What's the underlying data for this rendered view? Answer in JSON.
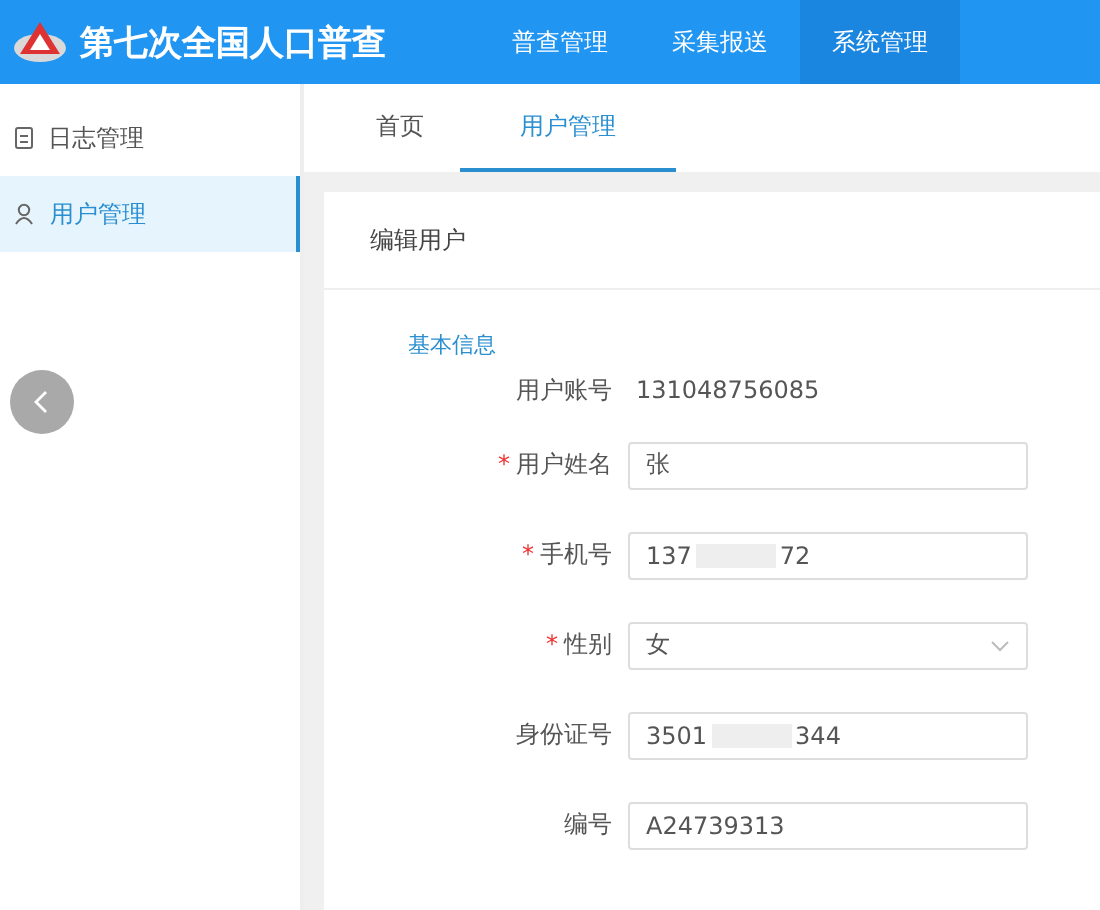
{
  "header": {
    "title": "第七次全国人口普查",
    "nav": [
      {
        "label": "普查管理",
        "selected": false
      },
      {
        "label": "采集报送",
        "selected": false
      },
      {
        "label": "系统管理",
        "selected": true
      }
    ]
  },
  "sidebar": {
    "items": [
      {
        "label": "日志管理",
        "kind": "log",
        "selected": false
      },
      {
        "label": "用户管理",
        "kind": "user",
        "selected": true
      }
    ]
  },
  "tabs": [
    {
      "label": "首页",
      "selected": false
    },
    {
      "label": "用户管理",
      "selected": true
    }
  ],
  "card": {
    "title": "编辑用户",
    "section": "基本信息",
    "fields": [
      {
        "kind": "text",
        "label": "用户账号",
        "start": "131048756085"
      },
      {
        "kind": "input",
        "label": "用户姓名",
        "required_mark": "*",
        "start": "张"
      },
      {
        "kind": "input",
        "label": "手机号",
        "required_mark": "*",
        "start": "137",
        "end": "72"
      },
      {
        "kind": "select",
        "label": "性别",
        "required_mark": "*",
        "start": "女"
      },
      {
        "kind": "input",
        "label": "身份证号",
        "start": "3501",
        "end": "344"
      },
      {
        "kind": "input",
        "label": "编号",
        "start": "A24739313"
      }
    ]
  }
}
